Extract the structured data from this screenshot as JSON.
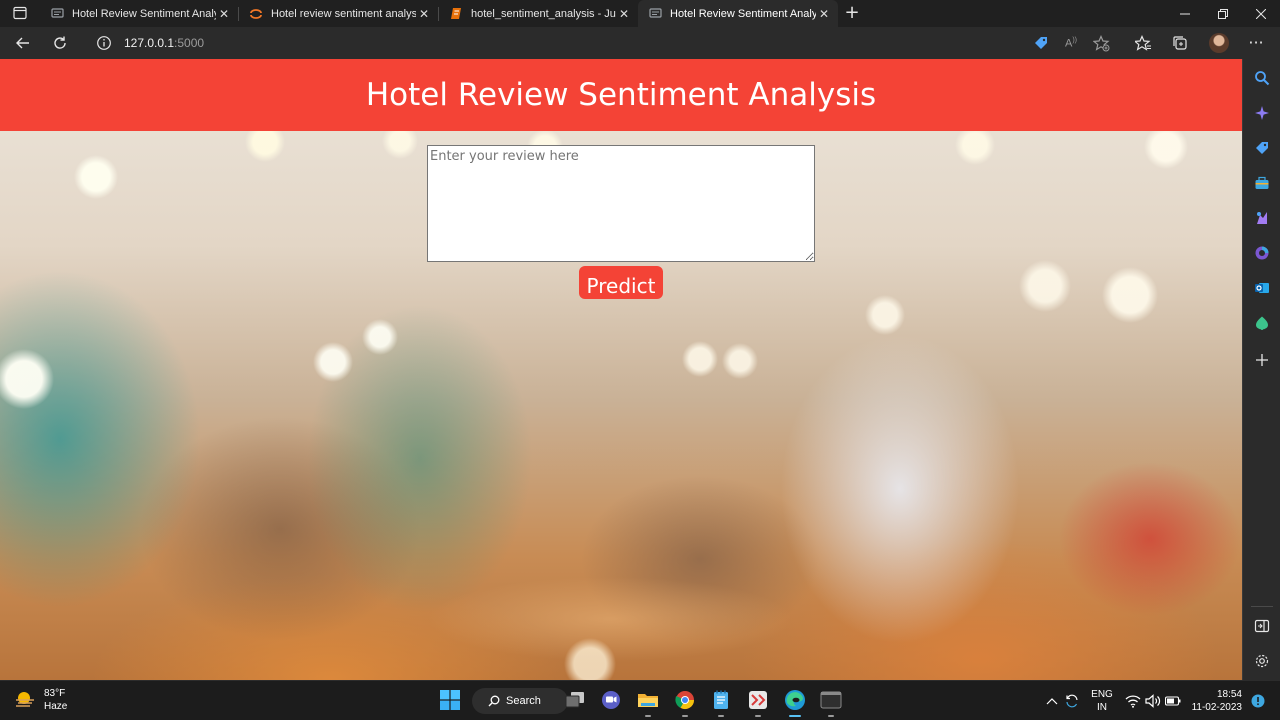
{
  "browser": {
    "tabs": [
      {
        "title": "Hotel Review Sentiment Analysis",
        "active": false
      },
      {
        "title": "Hotel review sentiment analysis/",
        "active": false
      },
      {
        "title": "hotel_sentiment_analysis - Jupyte",
        "active": false
      },
      {
        "title": "Hotel Review Sentiment Analysis",
        "active": true
      }
    ],
    "url_host": "127.0.0.1",
    "url_port": ":5000"
  },
  "page": {
    "title": "Hotel Review Sentiment Analysis",
    "review_placeholder": "Enter your review here",
    "predict_label": "Predict",
    "accent_color": "#f44336"
  },
  "taskbar": {
    "weather_temp": "83°F",
    "weather_desc": "Haze",
    "search_label": "Search",
    "lang_line1": "ENG",
    "lang_line2": "IN",
    "time": "18:54",
    "date": "11-02-2023"
  },
  "icons": {
    "sidebar": [
      "search-icon",
      "copilot-icon",
      "shopping-tag-icon",
      "tools-icon",
      "games-icon",
      "office-icon",
      "outlook-icon",
      "drop-icon",
      "add-icon",
      "split-screen-icon",
      "settings-icon"
    ],
    "taskbar_apps": [
      "windows-start-icon",
      "task-view-icon",
      "chat-icon",
      "file-explorer-icon",
      "chrome-icon",
      "notepad-icon",
      "app-icon",
      "edge-icon",
      "terminal-icon"
    ]
  }
}
